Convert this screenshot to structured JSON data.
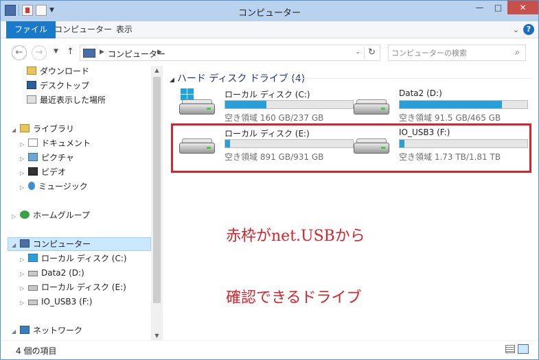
{
  "window": {
    "title": "コンピューター",
    "controls": {
      "minimize": "—",
      "maximize": "□",
      "close": "✕"
    }
  },
  "ribbon": {
    "tabs": [
      "ファイル",
      "コンピューター",
      "表示"
    ],
    "help": "?"
  },
  "address": {
    "path": "コンピューター",
    "search_placeholder": "コンピューターの検索"
  },
  "nav": {
    "favorites": [
      {
        "label": "ダウンロード",
        "icon": "download-folder-icon"
      },
      {
        "label": "デスクトップ",
        "icon": "desktop-icon"
      },
      {
        "label": "最近表示した場所",
        "icon": "recent-places-icon"
      }
    ],
    "libraries": {
      "label": "ライブラリ",
      "items": [
        "ドキュメント",
        "ピクチャ",
        "ビデオ",
        "ミュージック"
      ]
    },
    "homegroup": "ホームグループ",
    "computer": {
      "label": "コンピューター",
      "items": [
        "ローカル ディスク (C:)",
        "Data2 (D:)",
        "ローカル ディスク (E:)",
        "IO_USB3 (F:)"
      ]
    },
    "network": "ネットワーク"
  },
  "content": {
    "group_header": "ハード ディスク ドライブ (4)",
    "drives": [
      {
        "name": "ローカル ディスク (C:)",
        "free_text": "空き領域 160 GB/237 GB",
        "used_fraction": 0.32,
        "os": true
      },
      {
        "name": "Data2 (D:)",
        "free_text": "空き領域 91.5 GB/465 GB",
        "used_fraction": 0.8,
        "os": false
      },
      {
        "name": "ローカル ディスク (E:)",
        "free_text": "空き領域 891 GB/931 GB",
        "used_fraction": 0.04,
        "os": false
      },
      {
        "name": "IO_USB3 (F:)",
        "free_text": "空き領域 1.73 TB/1.81 TB",
        "used_fraction": 0.04,
        "os": false
      }
    ],
    "annotation_line1": "赤枠がnet.USBから",
    "annotation_line2": "確認できるドライブ"
  },
  "status": {
    "items_text": "4 個の項目"
  },
  "colors": {
    "accent": "#1979ca",
    "bar_fill": "#26a0da",
    "annotation": "#d9232c",
    "group_header": "#1e3287"
  }
}
